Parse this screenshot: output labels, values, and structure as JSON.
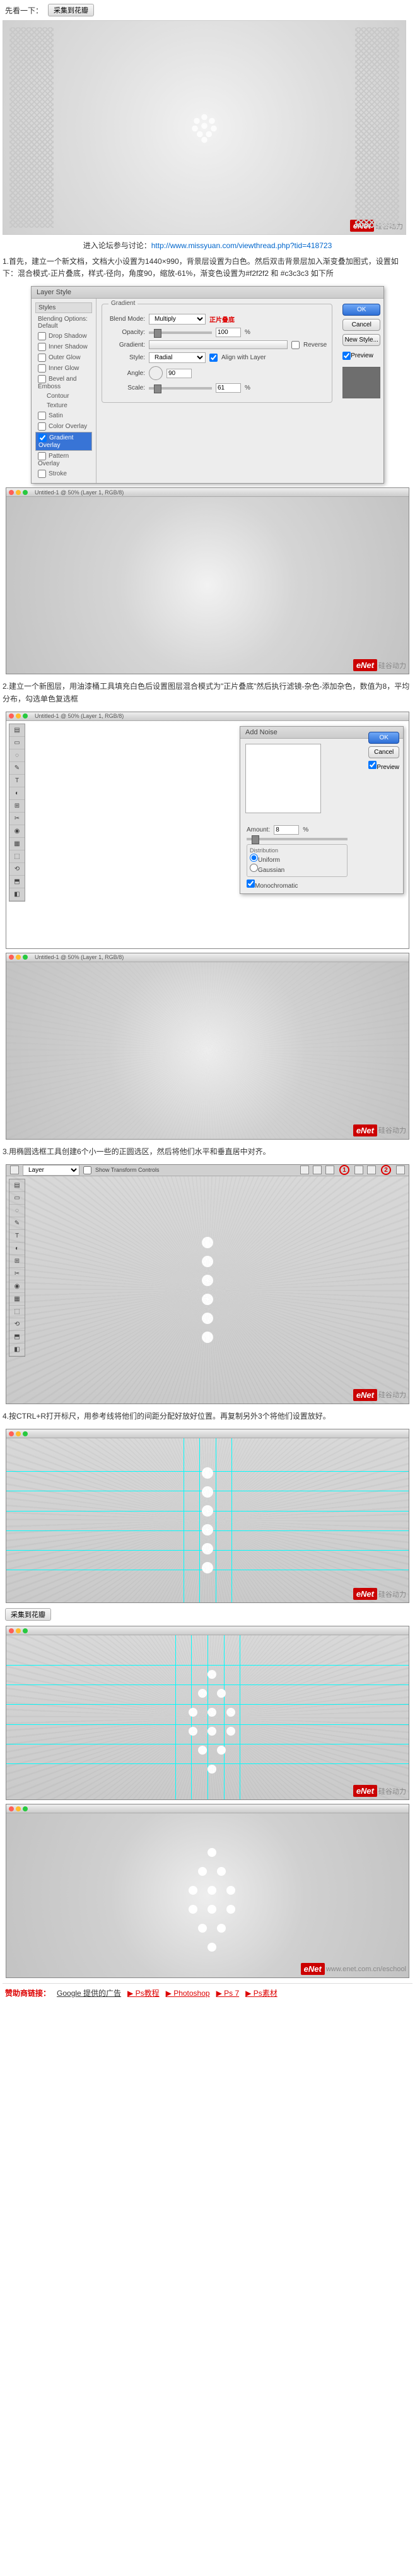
{
  "top": {
    "look": "先看一下：",
    "clip_btn": "采集到花瓣"
  },
  "caption": {
    "prefix": "进入论坛参与讨论：",
    "url": "http://www.missyuan.com/viewthread.php?tid=418723"
  },
  "step1": "1.首先，建立一个新文档，文档大小设置为1440×990，背景层设置为白色。然后双击背景层加入渐变叠加图式，设置如下：混合模式-正片叠底，样式-径向，角度90，缩放-61%，渐变色设置为#f2f2f2 和 #c3c3c3 如下所",
  "layer_style": {
    "title": "Layer Style",
    "left_head": "Styles",
    "left_default": "Blending Options: Default",
    "items": [
      "Drop Shadow",
      "Inner Shadow",
      "Outer Glow",
      "Inner Glow",
      "Bevel and Emboss",
      "Contour",
      "Texture",
      "Satin",
      "Color Overlay",
      "Gradient Overlay",
      "Pattern Overlay",
      "Stroke"
    ],
    "selected": "Gradient Overlay",
    "legend": "Gradient",
    "blend_label": "Blend Mode:",
    "blend_value": "Multiply",
    "blend_cn": "正片叠底",
    "opacity_label": "Opacity:",
    "opacity_value": "100",
    "gradient_label": "Gradient:",
    "reverse": "Reverse",
    "style_label": "Style:",
    "style_value": "Radial",
    "align": "Align with Layer",
    "angle_label": "Angle:",
    "angle_value": "90",
    "scale_label": "Scale:",
    "scale_value": "61",
    "percent": "%",
    "ok": "OK",
    "cancel": "Cancel",
    "new_style": "New Style...",
    "preview": "Preview"
  },
  "ps_win1_title": "Untitled-1 @ 50% (Layer 1, RGB/8)",
  "step2": "2.建立一个新图层，用油漆桶工具填充白色后设置图层混合模式为\"正片叠底\"然后执行滤镜-杂色-添加杂色，数值为8，平均分布，勾选单色复选框",
  "noise": {
    "title": "Add Noise",
    "ok": "OK",
    "cancel": "Cancel",
    "preview": "Preview",
    "amount_label": "Amount:",
    "amount_value": "8",
    "percent": "%",
    "dist_label": "Distribution",
    "uniform": "Uniform",
    "gaussian": "Gaussian",
    "mono": "Monochromatic"
  },
  "step3": "3.用椭圆选框工具创建6个小一些的正圆选区，然后将他们水平和垂直居中对齐。",
  "opts": {
    "layer": "Layer",
    "show": "Show Transform Controls"
  },
  "marker1": "1",
  "marker2": "2",
  "step4": "4.按CTRL+R打开标尺，用参考线将他们的间距分配好放好位置。再复制另外3个将他们设置放好。",
  "clip_btn2": "采集到花瓣",
  "watermark": {
    "logo": "eNet",
    "suffix": "硅谷动力",
    "sub": "www.enet.com.cn/eschool"
  },
  "links": {
    "lbl": "赞助商链接：",
    "google": "Google 提供的广告",
    "l1": "▶ Ps教程",
    "l2": "▶ Photoshop",
    "l3": "▶ Ps 7",
    "l4": "▶ Ps素材"
  },
  "tools": [
    "▤",
    "▭",
    "◌",
    "✎",
    "T",
    "◐",
    "⊞",
    "✂",
    "◉",
    "▦",
    "⬚",
    "⟲",
    "⬒",
    "◧"
  ]
}
